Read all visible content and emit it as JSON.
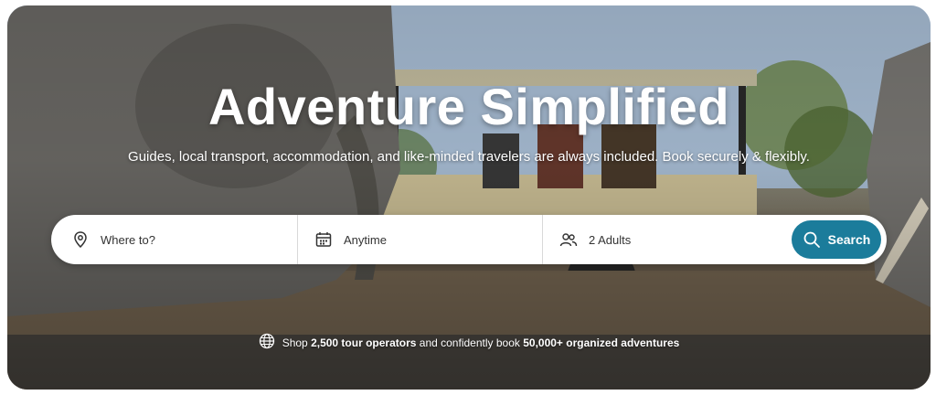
{
  "hero": {
    "title": "Adventure Simplified",
    "subtitle": "Guides, local transport, accommodation, and like-minded travelers are always included. Book securely & flexibly."
  },
  "search": {
    "where_placeholder": "Where to?",
    "when_value": "Anytime",
    "travelers_value": "2 Adults",
    "button_label": "Search",
    "accent": "#1b7c9b"
  },
  "footer": {
    "prefix": "Shop",
    "operators": "2,500 tour operators",
    "middle": "and confidently book",
    "adventures": "50,000+ organized adventures"
  },
  "icons": [
    "map-pin-icon",
    "calendar-icon",
    "users-icon",
    "search-icon",
    "globe-icon"
  ]
}
